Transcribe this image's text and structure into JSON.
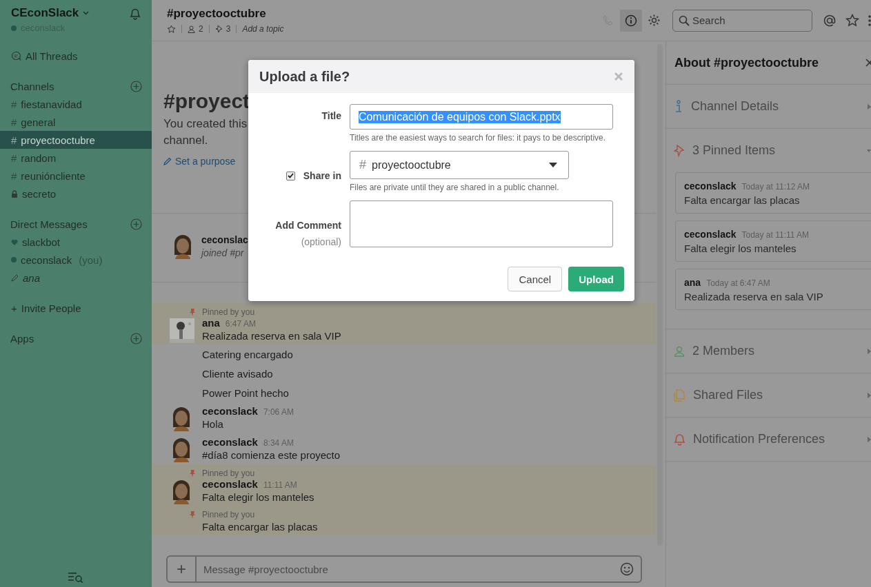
{
  "workspace": {
    "name": "CEconSlack",
    "user": "ceconslack"
  },
  "sidebar": {
    "all_threads": "All Threads",
    "channels_label": "Channels",
    "channels": [
      {
        "kind": "public",
        "prefix": "#",
        "name": "fiestanavidad",
        "selected": false
      },
      {
        "kind": "public",
        "prefix": "#",
        "name": "general",
        "selected": false
      },
      {
        "kind": "public",
        "prefix": "#",
        "name": "proyectooctubre",
        "selected": true
      },
      {
        "kind": "public",
        "prefix": "#",
        "name": "random",
        "selected": false
      },
      {
        "kind": "public",
        "prefix": "#",
        "name": "reunióncliente",
        "selected": false
      },
      {
        "kind": "private",
        "name": "secreto",
        "selected": false
      }
    ],
    "dm_label": "Direct Messages",
    "dms": [
      {
        "kind": "bot",
        "name": "slackbot"
      },
      {
        "kind": "online",
        "name": "ceconslack",
        "suffix": "(you)"
      },
      {
        "kind": "draft",
        "name": "ana"
      }
    ],
    "invite_plus": "+",
    "invite": "Invite People",
    "apps": "Apps"
  },
  "header": {
    "title": "#proyectooctubre",
    "members": "2",
    "pins": "3",
    "topic": "Add a topic",
    "search_placeholder": "Search"
  },
  "intro": {
    "title": "#proyect",
    "lines": [
      "You created this",
      "channel."
    ],
    "purpose": "Set a purpose"
  },
  "joined": {
    "author": "ceconslac",
    "text": "joined #pr"
  },
  "messages": [
    {
      "pinned": true,
      "pin_label": "Pinned by you",
      "author": "ana",
      "time": "6:47 AM",
      "text": "Realizada reserva en sala VIP"
    },
    {
      "kind": "plain",
      "pinned": false,
      "text": "Catering encargado"
    },
    {
      "kind": "plain",
      "pinned": false,
      "text": "Cliente avisado"
    },
    {
      "kind": "plain",
      "pinned": false,
      "text": "Power Point hecho"
    },
    {
      "kind": "figure",
      "pinned": false,
      "author": "ceconslack",
      "time": "7:06 AM",
      "text": "Hola"
    },
    {
      "kind": "figure",
      "pinned": false,
      "author": "ceconslack",
      "time": "8:34 AM",
      "text": "#día8 comienza este proyecto"
    },
    {
      "kind": "figure",
      "pinned": true,
      "pin_label": "Pinned by you",
      "author": "ceconslack",
      "time": "11:11 AM",
      "text": "Falta elegir los manteles"
    },
    {
      "kind": "plain",
      "pinned": true,
      "pin_label": "Pinned by you",
      "text": "Falta encargar las placas"
    }
  ],
  "composer": {
    "plus": "+",
    "placeholder": "Message #proyectooctubre"
  },
  "panel": {
    "title": "About #proyectooctubre",
    "sections": [
      {
        "kind": "details",
        "label": "Channel Details",
        "expanded": false
      },
      {
        "kind": "pins",
        "label": "3 Pinned Items",
        "expanded": true,
        "items": [
          {
            "author": "ceconslack",
            "time": "Today at 11:12 AM",
            "text": "Falta encargar las placas"
          },
          {
            "author": "ceconslack",
            "time": "Today at 11:11 AM",
            "text": "Falta elegir los manteles"
          },
          {
            "author": "ana",
            "time": "Today at 6:47 AM",
            "text": "Realizada reserva en sala VIP"
          }
        ]
      },
      {
        "kind": "members",
        "label": "2 Members",
        "expanded": false
      },
      {
        "kind": "files",
        "label": "Shared Files",
        "expanded": false
      },
      {
        "kind": "notifications",
        "label": "Notification Preferences",
        "expanded": false
      }
    ]
  },
  "modal": {
    "title": "Upload a file?",
    "title_label": "Title",
    "title_value": "Comunicación de equipos con Slack.pptx",
    "title_selected": true,
    "title_hint": "Titles are the easiest ways to search for files: it pays to be descriptive.",
    "share_checked": true,
    "share_label": "Share in",
    "share_prefix": "#",
    "share_value": "proyectooctubre",
    "share_hint": "Files are private until they are shared in a public channel.",
    "comment_label": "Add Comment",
    "comment_optional": "(optional)",
    "cancel": "Cancel",
    "upload": "Upload"
  }
}
